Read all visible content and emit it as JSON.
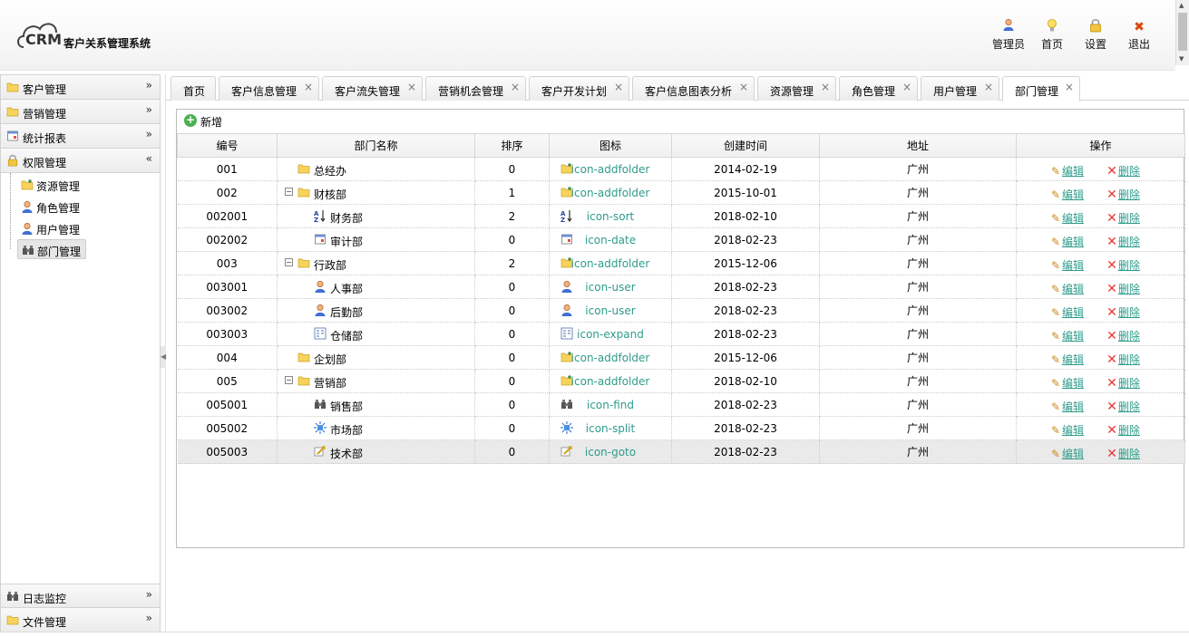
{
  "app": {
    "logo_text": "CRM",
    "title": "客户关系管理系统"
  },
  "topnav": [
    {
      "label": "管理员",
      "icon": "user-icon"
    },
    {
      "label": "首页",
      "icon": "bulb-icon"
    },
    {
      "label": "设置",
      "icon": "lock-icon"
    },
    {
      "label": "退出",
      "icon": "close-icon"
    }
  ],
  "sidebar": {
    "top_sections": [
      {
        "label": "客户管理",
        "icon": "folder-icon"
      },
      {
        "label": "营销管理",
        "icon": "folder-icon"
      },
      {
        "label": "统计报表",
        "icon": "date-icon"
      },
      {
        "label": "权限管理",
        "icon": "lock-icon"
      }
    ],
    "tree": [
      {
        "label": "资源管理",
        "icon": "addfolder-icon"
      },
      {
        "label": "角色管理",
        "icon": "user-icon"
      },
      {
        "label": "用户管理",
        "icon": "user-icon"
      },
      {
        "label": "部门管理",
        "icon": "find-icon",
        "selected": true
      }
    ],
    "bottom_sections": [
      {
        "label": "日志监控",
        "icon": "find-icon"
      },
      {
        "label": "文件管理",
        "icon": "folder-icon"
      }
    ]
  },
  "tabs": [
    {
      "label": "首页",
      "closable": false
    },
    {
      "label": "客户信息管理",
      "closable": true
    },
    {
      "label": "客户流失管理",
      "closable": true
    },
    {
      "label": "营销机会管理",
      "closable": true
    },
    {
      "label": "客户开发计划",
      "closable": true
    },
    {
      "label": "客户信息图表分析",
      "closable": true
    },
    {
      "label": "资源管理",
      "closable": true
    },
    {
      "label": "角色管理",
      "closable": true
    },
    {
      "label": "用户管理",
      "closable": true
    },
    {
      "label": "部门管理",
      "closable": true,
      "active": true
    }
  ],
  "toolbar": {
    "add_label": "新增"
  },
  "table": {
    "columns": [
      "编号",
      "部门名称",
      "排序",
      "图标",
      "创建时间",
      "地址",
      "操作"
    ],
    "edit_label": "编辑",
    "delete_label": "删除",
    "rows": [
      {
        "code": "001",
        "name": "总经办",
        "level": 0,
        "expander": "",
        "sort": "0",
        "icon": "icon-addfolder",
        "created": "2014-02-19",
        "address": "广州"
      },
      {
        "code": "002",
        "name": "财核部",
        "level": 0,
        "expander": "−",
        "sort": "1",
        "icon": "icon-addfolder",
        "created": "2015-10-01",
        "address": "广州"
      },
      {
        "code": "002001",
        "name": "财务部",
        "level": 1,
        "expander": "",
        "sort": "2",
        "icon": "icon-sort",
        "created": "2018-02-10",
        "address": "广州"
      },
      {
        "code": "002002",
        "name": "审计部",
        "level": 1,
        "expander": "",
        "sort": "0",
        "icon": "icon-date",
        "created": "2018-02-23",
        "address": "广州"
      },
      {
        "code": "003",
        "name": "行政部",
        "level": 0,
        "expander": "−",
        "sort": "2",
        "icon": "icon-addfolder",
        "created": "2015-12-06",
        "address": "广州"
      },
      {
        "code": "003001",
        "name": "人事部",
        "level": 1,
        "expander": "",
        "sort": "0",
        "icon": "icon-user",
        "created": "2018-02-23",
        "address": "广州"
      },
      {
        "code": "003002",
        "name": "后勤部",
        "level": 1,
        "expander": "",
        "sort": "0",
        "icon": "icon-user",
        "created": "2018-02-23",
        "address": "广州"
      },
      {
        "code": "003003",
        "name": "仓储部",
        "level": 1,
        "expander": "",
        "sort": "0",
        "icon": "icon-expand",
        "created": "2018-02-23",
        "address": "广州"
      },
      {
        "code": "004",
        "name": "企划部",
        "level": 0,
        "expander": "",
        "sort": "0",
        "icon": "icon-addfolder",
        "created": "2015-12-06",
        "address": "广州"
      },
      {
        "code": "005",
        "name": "营销部",
        "level": 0,
        "expander": "−",
        "sort": "0",
        "icon": "icon-addfolder",
        "created": "2018-02-10",
        "address": "广州"
      },
      {
        "code": "005001",
        "name": "销售部",
        "level": 1,
        "expander": "",
        "sort": "0",
        "icon": "icon-find",
        "created": "2018-02-23",
        "address": "广州"
      },
      {
        "code": "005002",
        "name": "市场部",
        "level": 1,
        "expander": "",
        "sort": "0",
        "icon": "icon-split",
        "created": "2018-02-23",
        "address": "广州"
      },
      {
        "code": "005003",
        "name": "技术部",
        "level": 1,
        "expander": "",
        "sort": "0",
        "icon": "icon-goto",
        "created": "2018-02-23",
        "address": "广州",
        "highlighted": true
      }
    ]
  }
}
